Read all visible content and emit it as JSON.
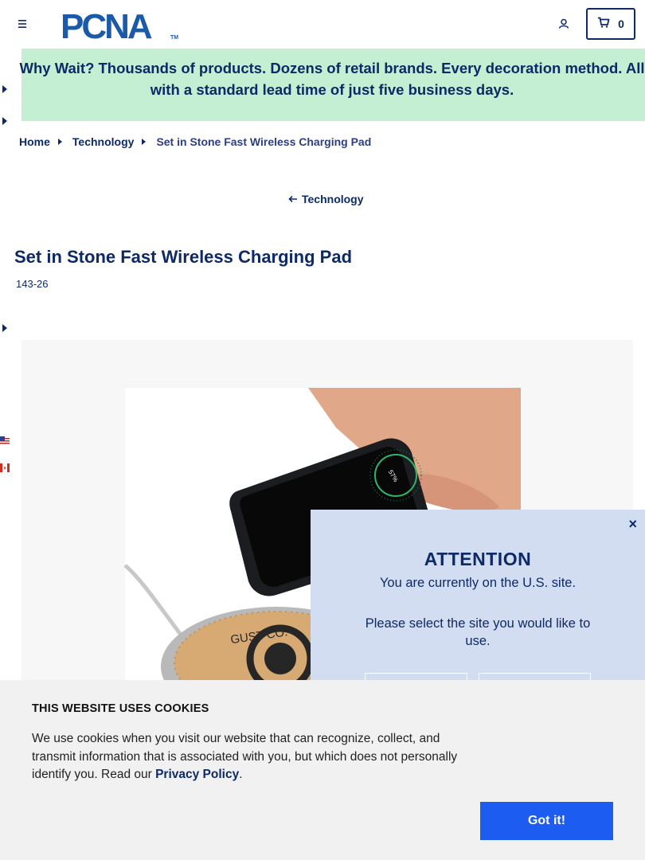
{
  "header": {
    "logo_text": "PCNA",
    "logo_tm": "TM",
    "cart_count": "0"
  },
  "promo": {
    "text": "Why Wait? Thousands of products. Dozens of retail brands. Every decoration method. All with a standard lead time of just five business days."
  },
  "breadcrumb": {
    "home": "Home",
    "category": "Technology",
    "current": "Set in Stone Fast Wireless Charging Pad"
  },
  "back_link": "Technology",
  "product": {
    "title": "Set in Stone Fast Wireless Charging Pad",
    "sku": "143-26",
    "pad_print": "GUST CO.",
    "phone_screen": "57%"
  },
  "modal": {
    "title": "ATTENTION",
    "line1": "You are currently on the U.S. site.",
    "line2": "Please select the site you would like to use.",
    "close": "×"
  },
  "cookie": {
    "title": "THIS WEBSITE USES COOKIES",
    "text": "We use cookies when you visit our website that can recognize, collect, and transmit information that is associated with you, but which does not personally identify you. Read our ",
    "link": "Privacy Policy",
    "after": ".",
    "button": "Got it!"
  },
  "colors": {
    "navy": "#0d2a66",
    "promo_bg": "#c4efd2",
    "modal_bg": "#d3ddf1",
    "cookie_button": "#1d5cf0"
  }
}
